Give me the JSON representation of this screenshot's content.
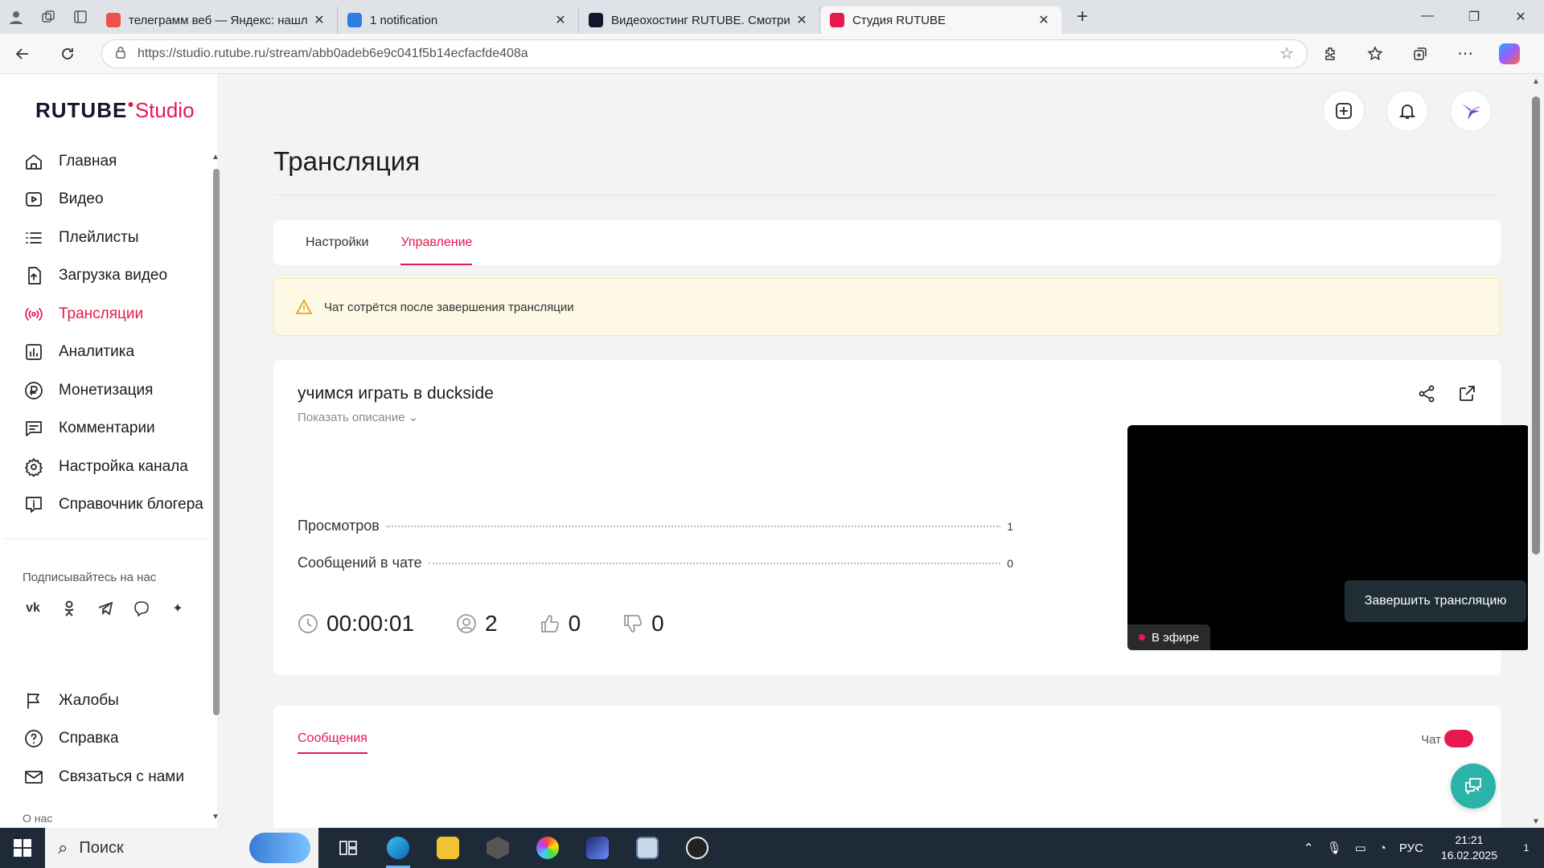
{
  "browser": {
    "tabs": [
      {
        "title": "телеграмм веб — Яндекс: нашл",
        "favicon": "yandex-icon",
        "color": "#f0504a",
        "active": false
      },
      {
        "title": "1 notification",
        "favicon": "notification-icon",
        "color": "#2f7de1",
        "active": false
      },
      {
        "title": "Видеохостинг RUTUBE. Смотри",
        "favicon": "rutube-icon",
        "color": "#13152d",
        "active": false
      },
      {
        "title": "Студия RUTUBE",
        "favicon": "rutube-studio-icon",
        "color": "#e5194e",
        "active": true
      }
    ],
    "url": "https://studio.rutube.ru/stream/abb0adeb6e9c041f5b14ecfacfde408a"
  },
  "logo": {
    "main": "RUTUBE",
    "suffix": "Studio"
  },
  "sidebar": {
    "items": [
      {
        "label": "Главная",
        "icon": "home-icon",
        "active": false
      },
      {
        "label": "Видео",
        "icon": "video-icon",
        "active": false
      },
      {
        "label": "Плейлисты",
        "icon": "list-icon",
        "active": false
      },
      {
        "label": "Загрузка видео",
        "icon": "upload-icon",
        "active": false
      },
      {
        "label": "Трансляции",
        "icon": "broadcast-icon",
        "active": true
      },
      {
        "label": "Аналитика",
        "icon": "analytics-icon",
        "active": false
      },
      {
        "label": "Монетизация",
        "icon": "ruble-icon",
        "active": false
      },
      {
        "label": "Комментарии",
        "icon": "comment-icon",
        "active": false
      },
      {
        "label": "Настройка канала",
        "icon": "gear-icon",
        "active": false
      },
      {
        "label": "Справочник блогера",
        "icon": "info-icon",
        "active": false
      }
    ],
    "subscribe_label": "Подписывайтесь на нас",
    "socials": [
      "vk-icon",
      "ok-icon",
      "telegram-icon",
      "viber-icon",
      "zen-icon"
    ],
    "items2": [
      {
        "label": "Жалобы",
        "icon": "flag-icon"
      },
      {
        "label": "Справка",
        "icon": "help-icon"
      },
      {
        "label": "Связаться с нами",
        "icon": "mail-icon"
      }
    ],
    "about": "О нас"
  },
  "page": {
    "title": "Трансляция",
    "tabs": [
      {
        "label": "Настройки",
        "active": false
      },
      {
        "label": "Управление",
        "active": true
      }
    ],
    "warning": "Чат сотрётся после завершения трансляции"
  },
  "stream": {
    "title": "учимся играть в duckside",
    "show_description": "Показать описание",
    "stats": [
      {
        "label": "Просмотров",
        "value": "1"
      },
      {
        "label": "Сообщений в чате",
        "value": "0"
      }
    ],
    "live_badge": "В эфире",
    "duration": "00:00:01",
    "viewers": "2",
    "likes": "0",
    "dislikes": "0",
    "end_button": "Завершить трансляцию"
  },
  "messages": {
    "tab": "Сообщения",
    "chat_label": "Чат"
  },
  "taskbar": {
    "search_placeholder": "Поиск",
    "language": "РУС",
    "time": "21:21",
    "date": "16.02.2025",
    "notifications": "1"
  },
  "colors": {
    "accent": "#e5194e",
    "dark_button": "#1f2d35",
    "warning_bg": "#fdf9e5"
  }
}
